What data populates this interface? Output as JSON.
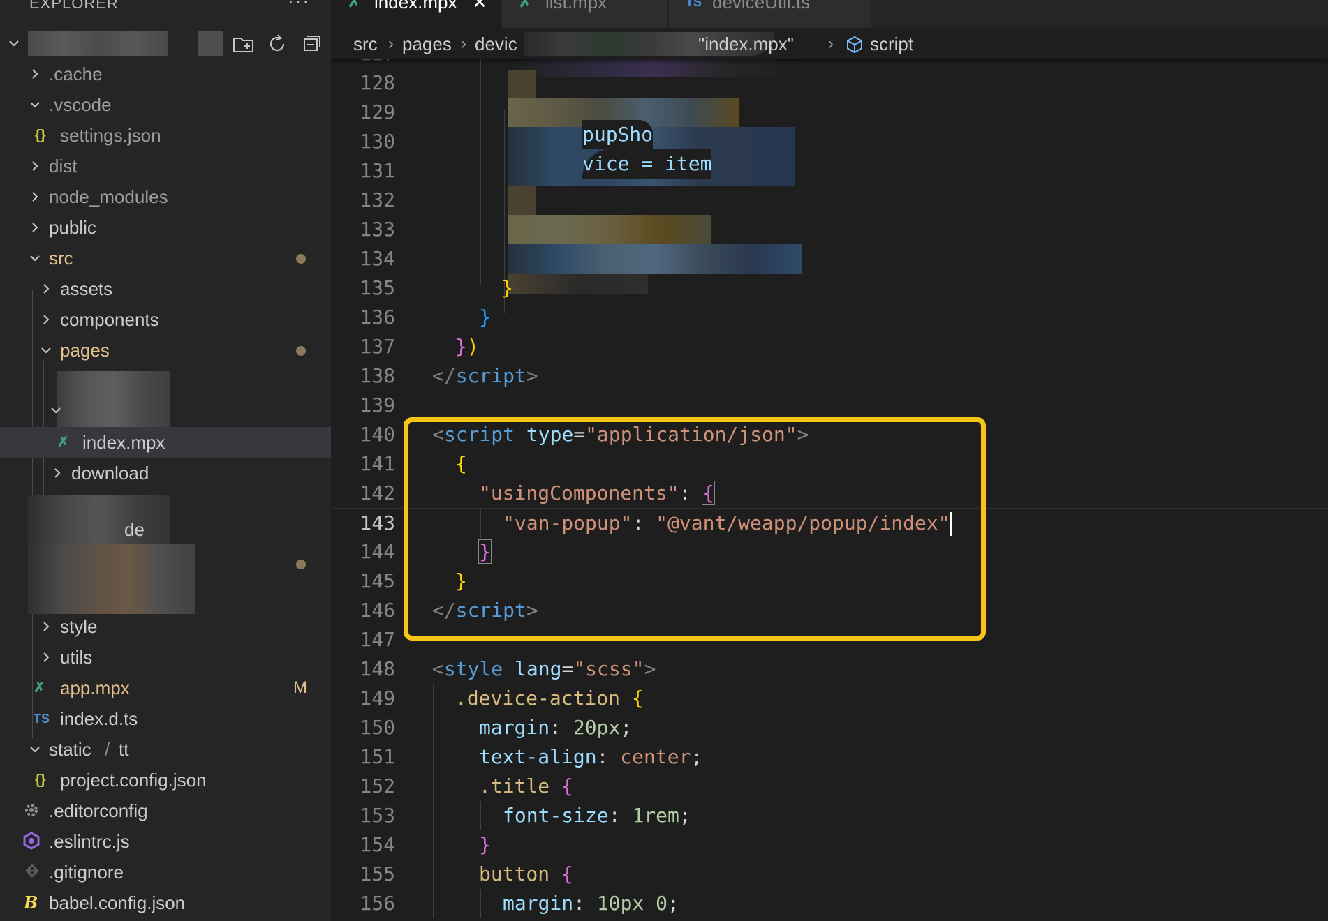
{
  "explorer": {
    "title": "EXPLORER",
    "more": "···",
    "items": [
      {
        "label": ".cache"
      },
      {
        "label": ".vscode"
      },
      {
        "label": "settings.json"
      },
      {
        "label": "dist"
      },
      {
        "label": "node_modules"
      },
      {
        "label": "public"
      },
      {
        "label": "src"
      },
      {
        "label": "assets"
      },
      {
        "label": "components"
      },
      {
        "label": "pages"
      },
      {
        "label": "index.mpx"
      },
      {
        "label": "download"
      },
      {
        "label": "style"
      },
      {
        "label": "utils"
      },
      {
        "label": "app.mpx",
        "badge": "M"
      },
      {
        "label": "index.d.ts"
      },
      {
        "label": "static",
        "label2": "tt"
      },
      {
        "label": "project.config.json"
      },
      {
        "label": ".editorconfig"
      },
      {
        "label": ".eslintrc.js"
      },
      {
        "label": ".gitignore"
      },
      {
        "label": "babel.config.json"
      }
    ],
    "icons": {
      "json": "{}",
      "ts": "TS",
      "mpx": "✗",
      "babel": "B"
    }
  },
  "tabs": [
    {
      "label": "index.mpx",
      "icon": "mpx-icon",
      "active": true
    },
    {
      "label": "list.mpx",
      "icon": "mpx-icon"
    },
    {
      "label": "deviceUtil.ts",
      "icon": "ts-icon",
      "icon_text": "TS"
    }
  ],
  "breadcrumb": {
    "parts": [
      "src",
      "pages",
      "devic",
      "\"index.mpx\"",
      "script"
    ]
  },
  "code": {
    "partial_130": "pupSho",
    "partial_131": "vice = item",
    "partial_sidebar": "de"
  },
  "colors": {
    "highlight": "#f5c518",
    "modified": "#e2c08d",
    "editor_bg": "#1e1e1e",
    "sidebar_bg": "#252526"
  }
}
